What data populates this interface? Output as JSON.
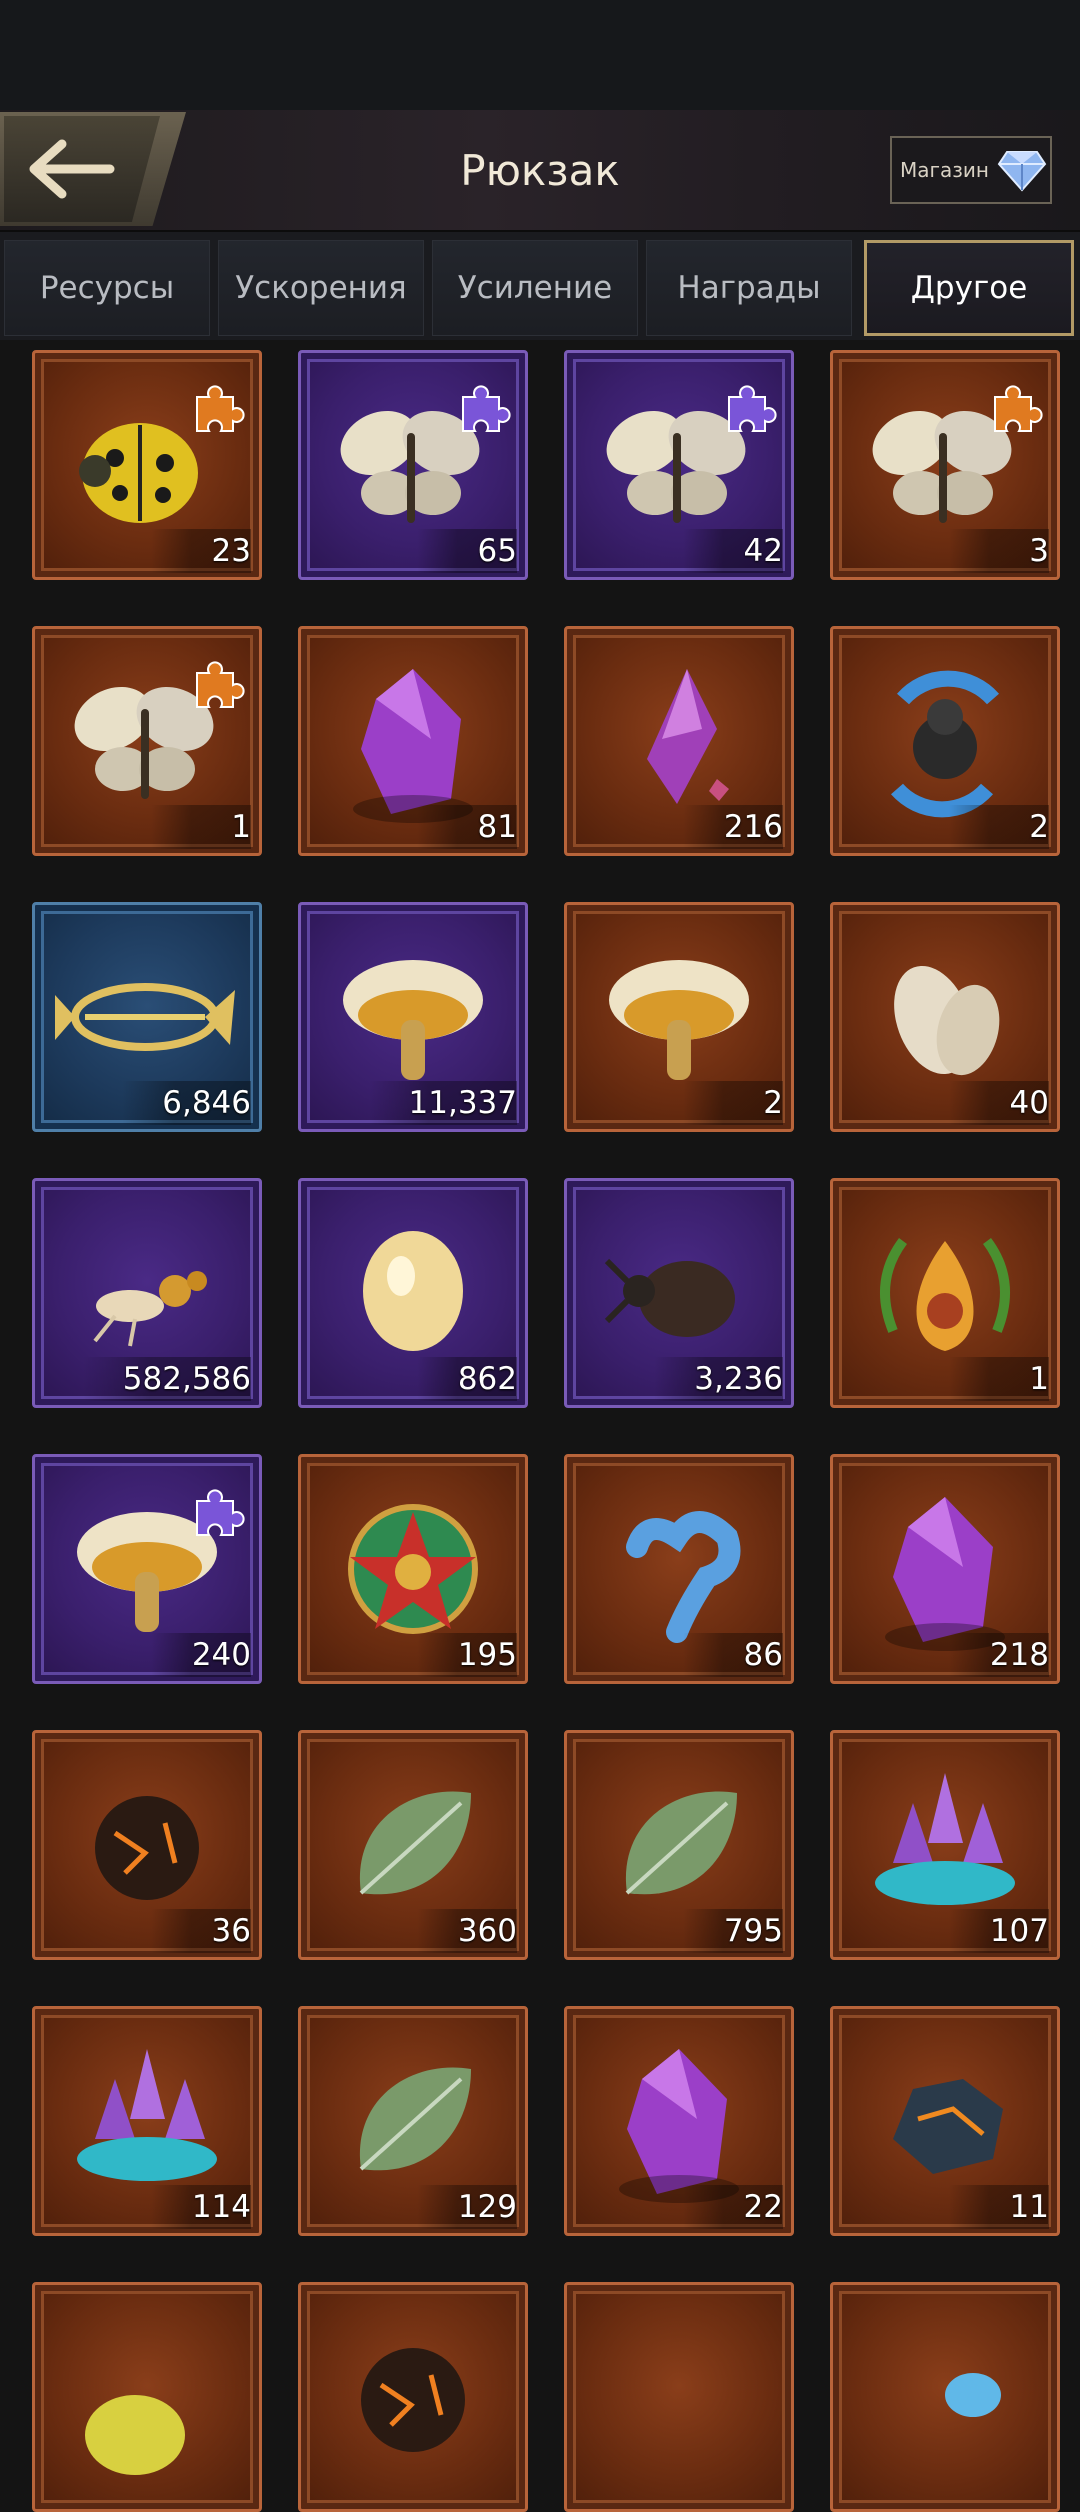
{
  "header": {
    "title": "Рюкзак",
    "shop_label": "Магазин"
  },
  "tabs": [
    {
      "label": "Ресурсы",
      "active": false
    },
    {
      "label": "Ускорения",
      "active": false
    },
    {
      "label": "Усиление",
      "active": false
    },
    {
      "label": "Награды",
      "active": false
    },
    {
      "label": "Другое",
      "active": true
    }
  ],
  "items": [
    {
      "name": "ladybug-fragment",
      "icon": "ladybug-icon",
      "frame": "orange",
      "count": "23",
      "fragment": true
    },
    {
      "name": "yellow-butterfly-fragment",
      "icon": "butterfly-icon",
      "frame": "purple",
      "count": "65",
      "fragment": true
    },
    {
      "name": "white-butterfly-fragment",
      "icon": "butterfly-icon",
      "frame": "purple",
      "count": "42",
      "fragment": true
    },
    {
      "name": "blue-butterfly-fragment",
      "icon": "butterfly-icon",
      "frame": "orange",
      "count": "3",
      "fragment": true
    },
    {
      "name": "spotted-butterfly-fragment",
      "icon": "butterfly-icon",
      "frame": "orange",
      "count": "1",
      "fragment": true
    },
    {
      "name": "purple-crystal",
      "icon": "crystal-icon",
      "frame": "orange",
      "count": "81",
      "fragment": false
    },
    {
      "name": "crystal-shard",
      "icon": "crystal-shard-icon",
      "frame": "orange",
      "count": "216",
      "fragment": false
    },
    {
      "name": "spider-exchange",
      "icon": "refresh-spider-icon",
      "frame": "orange",
      "count": "2",
      "fragment": false
    },
    {
      "name": "fish-skeleton",
      "icon": "fish-bone-icon",
      "frame": "blue",
      "count": "6,846",
      "fragment": false
    },
    {
      "name": "white-mushroom",
      "icon": "mushroom-icon",
      "frame": "purple",
      "count": "11,337",
      "fragment": false
    },
    {
      "name": "colorful-mushroom",
      "icon": "mushroom-icon",
      "frame": "orange",
      "count": "2",
      "fragment": false
    },
    {
      "name": "seeds",
      "icon": "seed-icon",
      "frame": "orange",
      "count": "40",
      "fragment": false
    },
    {
      "name": "termite",
      "icon": "ant-icon",
      "frame": "purple",
      "count": "582,586",
      "fragment": false
    },
    {
      "name": "egg",
      "icon": "egg-icon",
      "frame": "purple",
      "count": "862",
      "fragment": false
    },
    {
      "name": "beetle",
      "icon": "beetle-icon",
      "frame": "purple",
      "count": "3,236",
      "fragment": false
    },
    {
      "name": "laurel-drop-emblem",
      "icon": "laurel-badge-icon",
      "frame": "orange",
      "count": "1",
      "fragment": false
    },
    {
      "name": "pink-mushrooms-fragment",
      "icon": "mushroom-icon",
      "frame": "purple",
      "count": "240",
      "fragment": true
    },
    {
      "name": "star-medal",
      "icon": "medal-icon",
      "frame": "orange",
      "count": "195",
      "fragment": false
    },
    {
      "name": "blue-coral",
      "icon": "coral-icon",
      "frame": "orange",
      "count": "86",
      "fragment": false
    },
    {
      "name": "dark-crystal",
      "icon": "crystal-icon",
      "frame": "orange",
      "count": "218",
      "fragment": false
    },
    {
      "name": "lava-orb",
      "icon": "orb-icon",
      "frame": "orange",
      "count": "36",
      "fragment": false
    },
    {
      "name": "red-leaf",
      "icon": "leaf-icon",
      "frame": "orange",
      "count": "360",
      "fragment": false
    },
    {
      "name": "green-leaf",
      "icon": "leaf-icon",
      "frame": "orange",
      "count": "795",
      "fragment": false
    },
    {
      "name": "amethyst-cluster",
      "icon": "crystal-cluster-icon",
      "frame": "orange",
      "count": "107",
      "fragment": false
    },
    {
      "name": "aqua-crystals",
      "icon": "crystal-cluster-icon",
      "frame": "orange",
      "count": "114",
      "fragment": false
    },
    {
      "name": "blue-leaf",
      "icon": "leaf-icon",
      "frame": "orange",
      "count": "129",
      "fragment": false
    },
    {
      "name": "amber-crystal",
      "icon": "crystal-icon",
      "frame": "orange",
      "count": "22",
      "fragment": false
    },
    {
      "name": "lava-rock",
      "icon": "rock-icon",
      "frame": "orange",
      "count": "11",
      "fragment": false
    },
    {
      "name": "yellow-fruit",
      "icon": "fruit-icon",
      "frame": "orange",
      "count": "",
      "fragment": false
    },
    {
      "name": "golden-orb-item",
      "icon": "orb-icon",
      "frame": "orange",
      "count": "",
      "fragment": false
    },
    {
      "name": "hidden-item",
      "icon": "item-icon",
      "frame": "orange",
      "count": "",
      "fragment": false
    },
    {
      "name": "blue-gem-item",
      "icon": "gem-icon",
      "frame": "orange",
      "count": "",
      "fragment": false
    }
  ]
}
